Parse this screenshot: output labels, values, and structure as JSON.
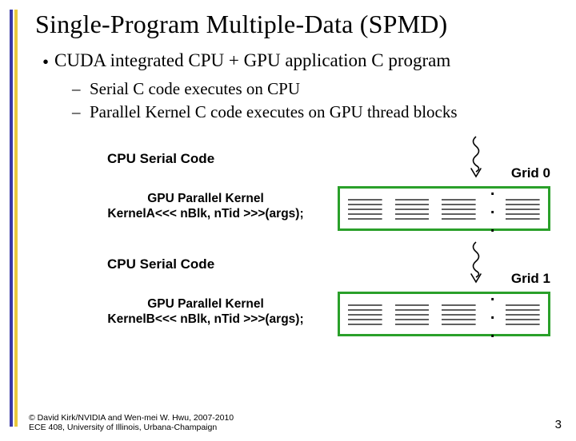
{
  "colors": {
    "accent_blue": "#3a3aa8",
    "accent_yellow": "#e8c83c",
    "grid_border": "#2aa02a"
  },
  "title": "Single-Program Multiple-Data (SPMD)",
  "bullet": "CUDA integrated CPU + GPU application C program",
  "sub": [
    "Serial C code executes on CPU",
    "Parallel Kernel C code executes on GPU thread blocks"
  ],
  "diagram": {
    "cpu_label": "CPU Serial Code",
    "gpu_label_a_line1": "GPU Parallel Kernel",
    "gpu_label_a_line2": "KernelA<<< nBlk, nTid >>>(args);",
    "gpu_label_b_line1": "GPU Parallel Kernel",
    "gpu_label_b_line2": "KernelB<<< nBlk, nTid >>>(args);",
    "grid0": "Grid 0",
    "grid1": "Grid 1",
    "ellipsis": ". . ."
  },
  "footer_line1": "© David Kirk/NVIDIA and Wen-mei W. Hwu, 2007-2010",
  "footer_line2": "ECE 408, University of Illinois, Urbana-Champaign",
  "page": "3"
}
